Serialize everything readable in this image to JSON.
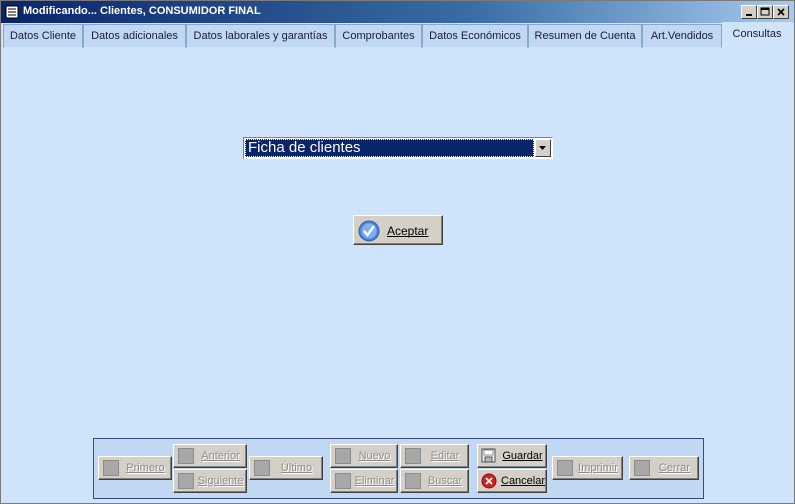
{
  "window": {
    "title": "Modificando... Clientes, CONSUMIDOR FINAL"
  },
  "tabs": [
    {
      "label": "Datos Cliente"
    },
    {
      "label": "Datos adicionales"
    },
    {
      "label": "Datos laborales y garantías"
    },
    {
      "label": "Comprobantes"
    },
    {
      "label": "Datos Económicos"
    },
    {
      "label": "Resumen de Cuenta"
    },
    {
      "label": "Art.Vendidos"
    },
    {
      "label": "Consultas",
      "active": true
    }
  ],
  "consulta": {
    "selected": "Ficha de clientes"
  },
  "accept_button": {
    "label": "Aceptar"
  },
  "toolbar": {
    "primero": "Primero",
    "anterior": "Anterior",
    "siguiente": "Siguiente",
    "ultimo": "Último",
    "nuevo": "Nuevo",
    "eliminar": "Eliminar",
    "editar": "Editar",
    "buscar": "Buscar",
    "guardar": "Guardar",
    "cancelar": "Cancelar",
    "imprimir": "Imprimir",
    "cerrar": "Cerrar"
  },
  "colors": {
    "accent": "#0a246a",
    "panel": "#cfe3fb",
    "cancel_icon": "#d42020"
  }
}
